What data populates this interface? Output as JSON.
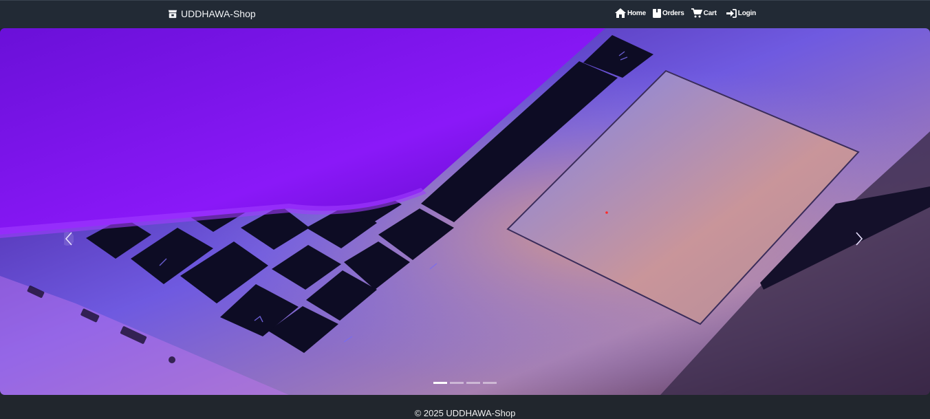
{
  "navbar": {
    "brand_label": "UDDHAWA-Shop",
    "brand_icon": "store-icon",
    "links": [
      {
        "label": "Home",
        "icon": "home-icon"
      },
      {
        "label": "Orders",
        "icon": "box-icon"
      },
      {
        "label": "Cart",
        "icon": "cart-icon"
      },
      {
        "label": "Login",
        "icon": "login-icon"
      }
    ]
  },
  "carousel": {
    "slide_count": 4,
    "active_index": 0,
    "prev_icon": "chevron-left-icon",
    "next_icon": "chevron-right-icon"
  },
  "footer": {
    "copyright": "© 2025 UDDHAWA-Shop"
  },
  "colors": {
    "navbar_bg": "#222a35",
    "footer_bg": "#21262d",
    "hero_purple": "#7a12f0",
    "hero_blue": "#3b5cf0"
  }
}
